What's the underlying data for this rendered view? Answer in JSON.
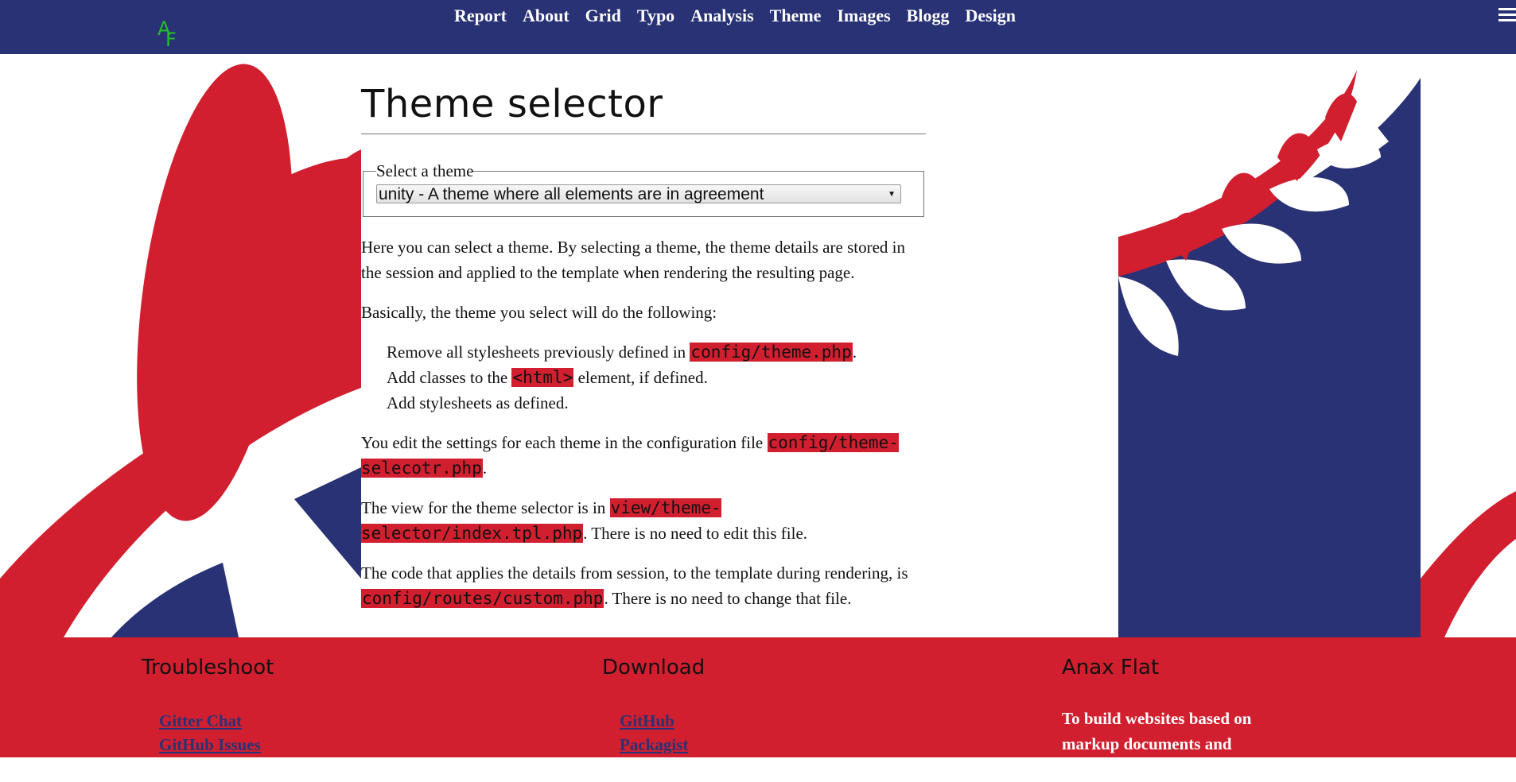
{
  "header": {
    "logo_text": "AF",
    "nav": [
      "Report",
      "About",
      "Grid",
      "Typo",
      "Analysis",
      "Theme",
      "Images",
      "Blogg",
      "Design"
    ]
  },
  "main": {
    "title": "Theme selector",
    "fieldset_legend": "Select a theme",
    "selected_theme": "unity - A theme where all elements are in agreement",
    "para1": "Here you can select a theme. By selecting a theme, the theme details are stored in the session and applied to the template when rendering the resulting page.",
    "para2": "Basically, the theme you select will do the following:",
    "list": [
      {
        "pre": "Remove all stylesheets previously defined in ",
        "code": "config/theme.php",
        "post": "."
      },
      {
        "pre": "Add classes to the ",
        "code": "<html>",
        "post": " element, if defined."
      },
      {
        "pre": "Add stylesheets as defined.",
        "code": "",
        "post": ""
      }
    ],
    "para3": {
      "pre": "You edit the settings for each theme in the configuration file ",
      "code": "config/theme-selecotr.php",
      "post": "."
    },
    "para4": {
      "pre": "The view for the theme selector is in ",
      "code": "view/theme-selector/index.tpl.php",
      "post": ". There is no need to edit this file."
    },
    "para5": {
      "pre": "The code that applies the details from session, to the template during rendering, is ",
      "code": "config/routes/custom.php",
      "post": ". There is no need to change that file."
    }
  },
  "footer": {
    "col1": {
      "title": "Troubleshoot",
      "links": [
        "Gitter Chat",
        "GitHub Issues"
      ]
    },
    "col2": {
      "title": "Download",
      "links": [
        "GitHub",
        "Packagist"
      ]
    },
    "col3": {
      "title": "Anax Flat",
      "desc": "To build websites based on markup documents and configuration in YAML."
    }
  },
  "colors": {
    "navy": "#293274",
    "red": "#d11f2f"
  }
}
